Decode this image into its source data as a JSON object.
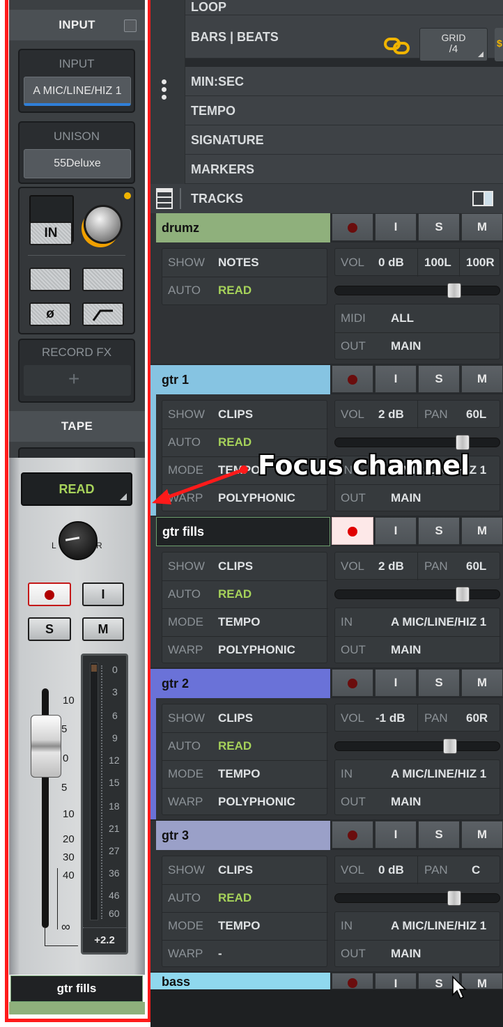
{
  "left_panel": {
    "input_header": "INPUT",
    "input_box": {
      "label": "INPUT",
      "value": "A MIC/LINE/HIZ 1"
    },
    "unison_box": {
      "label": "UNISON",
      "value": "55Deluxe"
    },
    "in_button": "IN",
    "phase_button": "ø",
    "record_fx": {
      "label": "RECORD FX",
      "add_symbol": "+"
    },
    "tape_header": "TAPE",
    "automation": "READ",
    "pan_left": "L",
    "pan_right": "R",
    "input_monitor_button": "I",
    "solo_button": "S",
    "mute_button": "M",
    "fader_scale": [
      "10",
      "5",
      "0",
      "5",
      "10",
      "20",
      "30",
      "40",
      "∞"
    ],
    "meter_scale": [
      "0",
      "3",
      "6",
      "9",
      "12",
      "15",
      "18",
      "21",
      "27",
      "36",
      "46",
      "60"
    ],
    "meter_peak": "+2.2",
    "channel_name": "gtr fills"
  },
  "ruler": {
    "rows": [
      "LOOP",
      "BARS | BEATS",
      "MIN:SEC",
      "TEMPO",
      "SIGNATURE",
      "MARKERS"
    ],
    "grid_label": "GRID",
    "grid_value": "/4",
    "tracks_header": "TRACKS"
  },
  "tracks": [
    {
      "name": "drumz",
      "color": "#8fb07c",
      "record_armed": false,
      "input": "I",
      "solo": "S",
      "mute": "M",
      "show": "NOTES",
      "auto": "READ",
      "vol": "0 dB",
      "left": "100L",
      "right": "100R",
      "midi": "ALL",
      "out": "MAIN"
    },
    {
      "name": "gtr 1",
      "color": "#86c4e2",
      "record_armed": false,
      "input": "I",
      "solo": "S",
      "mute": "M",
      "show": "CLIPS",
      "auto": "READ",
      "mode": "TEMPO",
      "warp": "POLYPHONIC",
      "vol": "2 dB",
      "pan": "60L",
      "in": "A MIC/LINE/HIZ 1",
      "out": "MAIN"
    },
    {
      "name": "gtr fills",
      "color": "#1f2224",
      "record_armed": true,
      "input": "I",
      "solo": "S",
      "mute": "M",
      "show": "CLIPS",
      "auto": "READ",
      "mode": "TEMPO",
      "warp": "POLYPHONIC",
      "vol": "2 dB",
      "pan": "60L",
      "in": "A MIC/LINE/HIZ 1",
      "out": "MAIN"
    },
    {
      "name": "gtr 2",
      "color": "#6a72d8",
      "record_armed": false,
      "input": "I",
      "solo": "S",
      "mute": "M",
      "show": "CLIPS",
      "auto": "READ",
      "mode": "TEMPO",
      "warp": "POLYPHONIC",
      "vol": "-1 dB",
      "pan": "60R",
      "in": "A MIC/LINE/HIZ 1",
      "out": "MAIN"
    },
    {
      "name": "gtr 3",
      "color": "#9aa0c8",
      "record_armed": false,
      "input": "I",
      "solo": "S",
      "mute": "M",
      "show": "CLIPS",
      "auto": "READ",
      "mode": "TEMPO",
      "warp": "-",
      "vol": "0 dB",
      "pan": "C",
      "in": "A MIC/LINE/HIZ 1",
      "out": "MAIN"
    },
    {
      "name": "bass",
      "color": "#8fd8ee",
      "input": "I",
      "solo": "S",
      "mute": "M"
    }
  ],
  "labels": {
    "show": "SHOW",
    "auto": "AUTO",
    "mode": "MODE",
    "warp": "WARP",
    "vol": "VOL",
    "pan": "PAN",
    "in": "IN",
    "midi": "MIDI",
    "out": "OUT"
  },
  "annotation": "Focus channel",
  "colors": {
    "highlight": "#ff1a1a",
    "read_green": "#a6d25a",
    "link_gold": "#f0b400"
  }
}
